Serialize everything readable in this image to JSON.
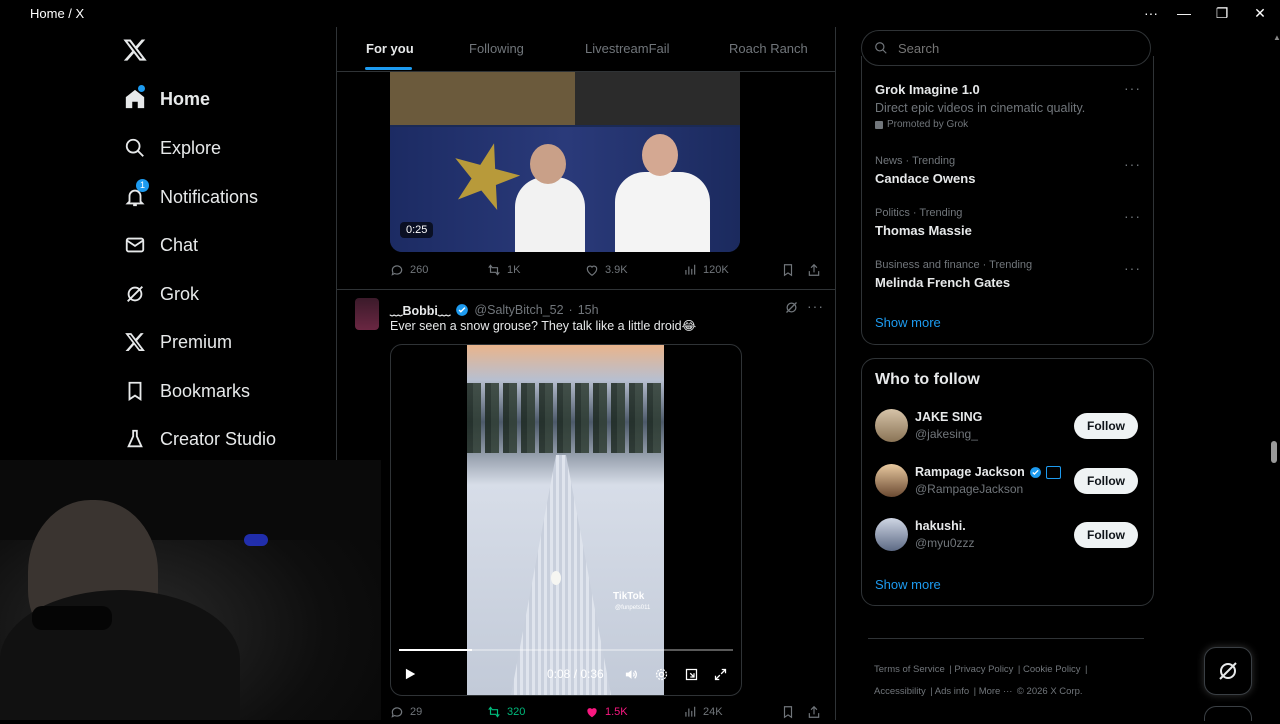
{
  "window": {
    "title": "Home / X"
  },
  "nav": {
    "items": [
      {
        "label": "Home",
        "icon": "home-icon"
      },
      {
        "label": "Explore",
        "icon": "search-icon"
      },
      {
        "label": "Notifications",
        "icon": "bell-icon",
        "badge": "1"
      },
      {
        "label": "Chat",
        "icon": "mail-icon"
      },
      {
        "label": "Grok",
        "icon": "grok-icon"
      },
      {
        "label": "Premium",
        "icon": "x-icon"
      },
      {
        "label": "Bookmarks",
        "icon": "bookmark-icon"
      },
      {
        "label": "Creator Studio",
        "icon": "flask-icon"
      }
    ]
  },
  "tabs": [
    "For you",
    "Following",
    "LivestreamFail",
    "Roach Ranch"
  ],
  "tweet1": {
    "video_time": "0:25",
    "replies": "260",
    "reposts": "1K",
    "likes": "3.9K",
    "views": "120K"
  },
  "tweet2": {
    "display_name": "﹏Bobbi﹏",
    "handle": "@SaltyBitch_52",
    "time": "15h",
    "text": "Ever seen a snow grouse? They talk like a little droid😂",
    "watermark": "TikTok",
    "watermark_user": "@funpets011",
    "video_time": "0:08 / 0:36",
    "video_progress": 0.22,
    "replies": "29",
    "reposts": "320",
    "likes": "1.5K",
    "views": "24K"
  },
  "search": {
    "placeholder": "Search"
  },
  "trends": {
    "items": [
      {
        "title": "Grok Imagine 1.0",
        "desc": "Direct epic videos in cinematic quality.",
        "promo": "Promoted by Grok"
      },
      {
        "meta": "News · Trending",
        "title": "Candace Owens"
      },
      {
        "meta": "Politics · Trending",
        "title": "Thomas Massie"
      },
      {
        "meta": "Business and finance · Trending",
        "title": "Melinda French Gates"
      }
    ],
    "show_more": "Show more"
  },
  "who_to_follow": {
    "title": "Who to follow",
    "users": [
      {
        "name": "JAKE SING",
        "handle": "@jakesing_",
        "button": "Follow"
      },
      {
        "name": "Rampage Jackson",
        "handle": "@RampageJackson",
        "button": "Follow"
      },
      {
        "name": "hakushi.",
        "handle": "@myu0zzz",
        "button": "Follow"
      }
    ],
    "show_more": "Show more"
  },
  "footer": {
    "links": [
      "Terms of Service",
      "Privacy Policy",
      "Cookie Policy",
      "Accessibility",
      "Ads info",
      "More ···"
    ],
    "copyright": "© 2026 X Corp."
  },
  "colors": {
    "accent": "#1d9bf0",
    "like": "#f91880",
    "repost": "#00ba7c",
    "border": "#2f3336"
  }
}
